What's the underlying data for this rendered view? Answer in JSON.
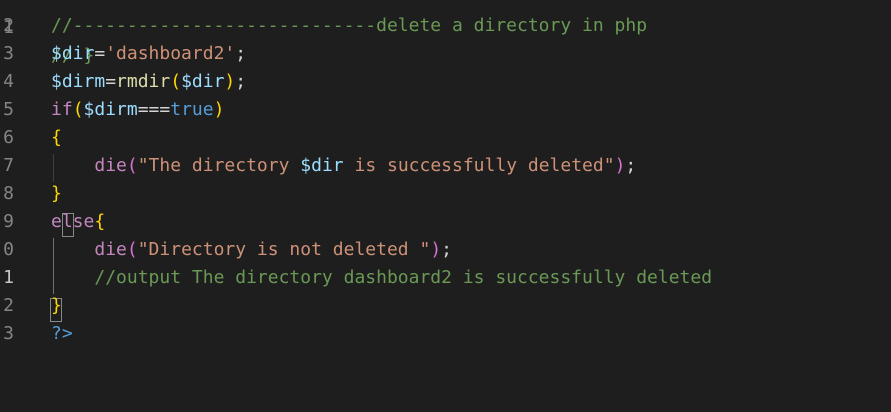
{
  "editor": {
    "lines": [
      {
        "number": "2",
        "tokens": [
          {
            "text": "//----------------------------delete a directory in php",
            "kind": "comment"
          }
        ]
      },
      {
        "number": "3",
        "tokens": [
          {
            "text": "$dir",
            "kind": "var"
          },
          {
            "text": "=",
            "kind": "op"
          },
          {
            "text": "'dashboard2'",
            "kind": "str"
          },
          {
            "text": ";",
            "kind": "op"
          }
        ]
      },
      {
        "number": "4",
        "tokens": [
          {
            "text": "$dirm",
            "kind": "var"
          },
          {
            "text": "=",
            "kind": "op"
          },
          {
            "text": "rmdir",
            "kind": "fn"
          },
          {
            "text": "(",
            "kind": "b1"
          },
          {
            "text": "$dir",
            "kind": "var"
          },
          {
            "text": ")",
            "kind": "b1"
          },
          {
            "text": ";",
            "kind": "op"
          }
        ]
      },
      {
        "number": "5",
        "tokens": [
          {
            "text": "if",
            "kind": "kw"
          },
          {
            "text": "(",
            "kind": "b1"
          },
          {
            "text": "$dirm",
            "kind": "var"
          },
          {
            "text": "===",
            "kind": "op"
          },
          {
            "text": "true",
            "kind": "const"
          },
          {
            "text": ")",
            "kind": "b1"
          }
        ]
      },
      {
        "number": "6",
        "tokens": [
          {
            "text": "{",
            "kind": "b1"
          }
        ]
      },
      {
        "number": "7",
        "tokens": [
          {
            "text": "    ",
            "kind": "op"
          },
          {
            "text": "die",
            "kind": "kw"
          },
          {
            "text": "(",
            "kind": "b2"
          },
          {
            "text": "\"The directory ",
            "kind": "str"
          },
          {
            "text": "$dir",
            "kind": "var"
          },
          {
            "text": " is successfully deleted\"",
            "kind": "str"
          },
          {
            "text": ")",
            "kind": "b2"
          },
          {
            "text": ";",
            "kind": "op"
          }
        ]
      },
      {
        "number": "8",
        "tokens": [
          {
            "text": "}",
            "kind": "b1"
          }
        ]
      },
      {
        "number": "9",
        "tokens": [
          {
            "text": "else",
            "kind": "kw"
          },
          {
            "text": "{",
            "kind": "b1"
          }
        ]
      },
      {
        "number": "0",
        "tokens": [
          {
            "text": "    ",
            "kind": "op"
          },
          {
            "text": "die",
            "kind": "kw"
          },
          {
            "text": "(",
            "kind": "b2"
          },
          {
            "text": "\"Directory is not deleted \"",
            "kind": "str"
          },
          {
            "text": ")",
            "kind": "b2"
          },
          {
            "text": ";",
            "kind": "op"
          }
        ]
      },
      {
        "number": "1",
        "active": true,
        "tokens": [
          {
            "text": "    ",
            "kind": "op"
          },
          {
            "text": "//output The directory dashboard2 is successfully deleted",
            "kind": "comment"
          }
        ]
      },
      {
        "number": "2",
        "tokens": [
          {
            "text": "}",
            "kind": "b1"
          }
        ]
      },
      {
        "number": "3",
        "tokens": [
          {
            "text": "?>",
            "kind": "tag"
          }
        ]
      }
    ]
  },
  "colors": {
    "background": "#1e1e1e",
    "comment": "#6a9955",
    "variable": "#9cdcfe",
    "string": "#ce9178",
    "function": "#dcdcaa",
    "keyword": "#c586c0",
    "constant": "#569cd6",
    "bracket_level1": "#ffd700",
    "bracket_level2": "#da70d6"
  }
}
